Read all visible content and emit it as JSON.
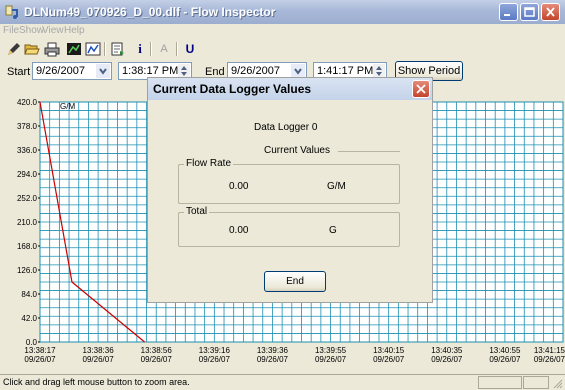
{
  "window": {
    "title": "DLNum49_070926_D_00.dlf - Flow Inspector"
  },
  "menu": {
    "items": [
      "File",
      "Show",
      "View",
      "Help"
    ]
  },
  "toolbar": {
    "tools": [
      "pencil-icon",
      "open-folder-icon",
      "print-icon",
      "chart-grid-icon",
      "line-chart-icon",
      "export-icon",
      "info-icon",
      "text-a-icon",
      "text-u-icon"
    ],
    "info_label": "i",
    "a_label": "A",
    "u_label": "U"
  },
  "period": {
    "start_label": "Start",
    "start_date": "9/26/2007",
    "start_time": "1:38:17 PM",
    "end_label": "End",
    "end_date": "9/26/2007",
    "end_time": "1:41:17 PM",
    "show_button": "Show Period"
  },
  "chart_data": {
    "type": "line",
    "ylabel": "G/M",
    "ylim": [
      0,
      420
    ],
    "yticks": [
      "420.0",
      "378.0",
      "336.0",
      "294.0",
      "252.0",
      "210.0",
      "168.0",
      "126.0",
      "84.0",
      "42.0",
      "0.0"
    ],
    "xticks": [
      {
        "time": "13:38:17",
        "date": "09/26/07"
      },
      {
        "time": "13:38:36",
        "date": "09/26/07"
      },
      {
        "time": "13:38:56",
        "date": "09/26/07"
      },
      {
        "time": "13:39:16",
        "date": "09/26/07"
      },
      {
        "time": "13:39:36",
        "date": "09/26/07"
      },
      {
        "time": "13:39:55",
        "date": "09/26/07"
      },
      {
        "time": "13:40:15",
        "date": "09/26/07"
      },
      {
        "time": "13:40:35",
        "date": "09/26/07"
      },
      {
        "time": "13:40:55",
        "date": "09/26/07"
      },
      {
        "time": "13:41:15",
        "date": "09/26/07"
      }
    ],
    "xlim": [
      0,
      180
    ],
    "series": [
      {
        "x": [
          0,
          11,
          36
        ],
        "y": [
          420,
          105,
          0
        ],
        "color": "#cc0000"
      }
    ],
    "grid": true,
    "grid_color": "#1c8fb0"
  },
  "status": {
    "text": "Click and drag left mouse button to zoom area."
  },
  "dialog": {
    "title": "Current Data Logger Values",
    "logger_label": "Data Logger  0",
    "current_values_label": "Current Values",
    "flow_rate_label": "Flow Rate",
    "flow_rate_value": "0.00",
    "flow_rate_unit": "G/M",
    "total_label": "Total",
    "total_value": "0.00",
    "total_unit": "G",
    "end_button": "End"
  }
}
